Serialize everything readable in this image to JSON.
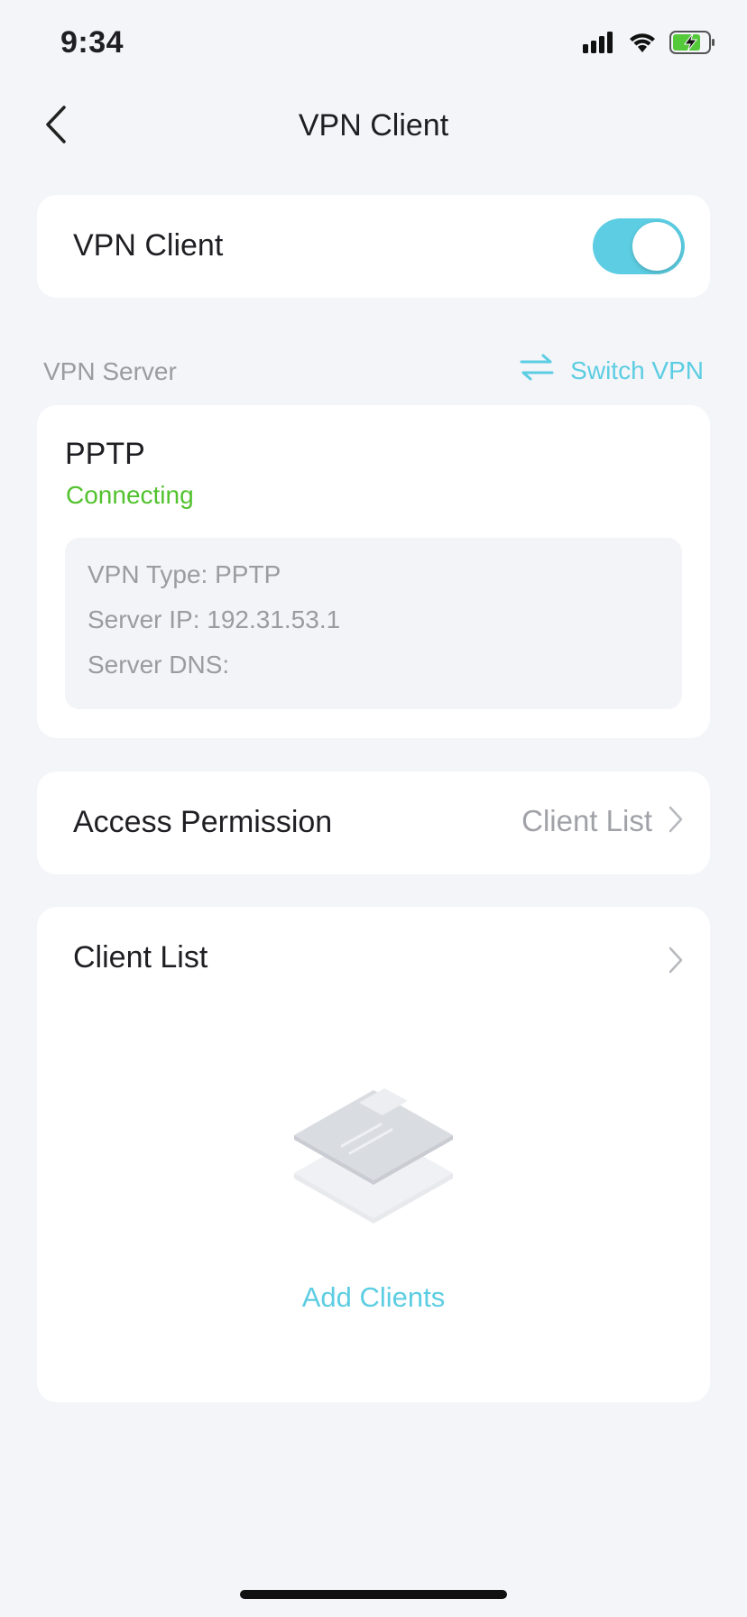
{
  "status_bar": {
    "time": "9:34"
  },
  "nav": {
    "title": "VPN Client"
  },
  "vpn_toggle": {
    "label": "VPN Client",
    "enabled": true
  },
  "vpn_server_section": {
    "label": "VPN Server",
    "switch_label": "Switch VPN"
  },
  "server": {
    "name": "PPTP",
    "status": "Connecting",
    "details": [
      "VPN Type: PPTP",
      "Server IP: 192.31.53.1",
      "Server DNS:"
    ]
  },
  "access_permission": {
    "label": "Access Permission",
    "value": "Client List"
  },
  "client_list": {
    "label": "Client List",
    "add_label": "Add Clients"
  },
  "colors": {
    "accent": "#5ccde2",
    "status_green": "#52c22e",
    "background": "#f3f5f9"
  }
}
